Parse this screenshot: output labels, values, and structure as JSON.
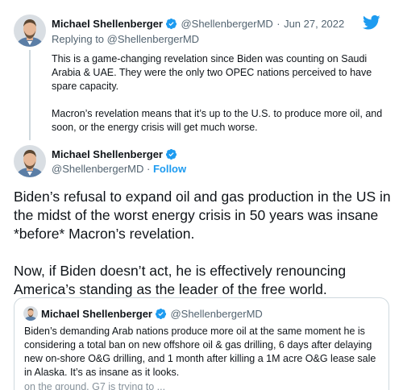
{
  "parent_tweet": {
    "author_name": "Michael Shellenberger",
    "author_handle": "@ShellenbergerMD",
    "separator": "·",
    "date": "Jun 27, 2022",
    "replying_prefix": "Replying to",
    "replying_handle": "@ShellenbergerMD",
    "paragraph_1": "This is a game-changing revelation since Biden was counting on Saudi Arabia & UAE. They were the only two OPEC nations perceived to have spare capacity.",
    "paragraph_2": "Macron’s revelation means that it’s up to the U.S. to produce more oil, and soon, or the energy crisis will get much worse."
  },
  "main_tweet": {
    "author_name": "Michael Shellenberger",
    "author_handle": "@ShellenbergerMD",
    "separator": "·",
    "follow_label": "Follow",
    "paragraph_1": "Biden’s refusal to expand oil and gas production in the US in the midst of the worst energy crisis in 50 years was insane *before* Macron’s revelation.",
    "paragraph_2": "Now, if Biden doesn’t act, he is effectively renouncing America’s standing as the leader of the free world."
  },
  "quoted_tweet": {
    "author_name": "Michael Shellenberger",
    "author_handle": "@ShellenbergerMD",
    "text": "Biden’s demanding Arab nations produce more oil at the same moment he is considering a total ban on new offshore oil & gas drilling, 6 days after delaying new on-shore O&G drilling, and 1 month after killing a 1M acre O&G lease sale in Alaska. It’s as insane as it looks.",
    "cut_off_text": "on the ground. G7 is trying to ..."
  },
  "icons": {
    "verified": "verified-badge-icon",
    "brand": "twitter-bird-icon"
  },
  "colors": {
    "brand_blue": "#1d9bf0",
    "text_primary": "#0f1419",
    "text_secondary": "#536471",
    "border": "#cfd9de"
  }
}
